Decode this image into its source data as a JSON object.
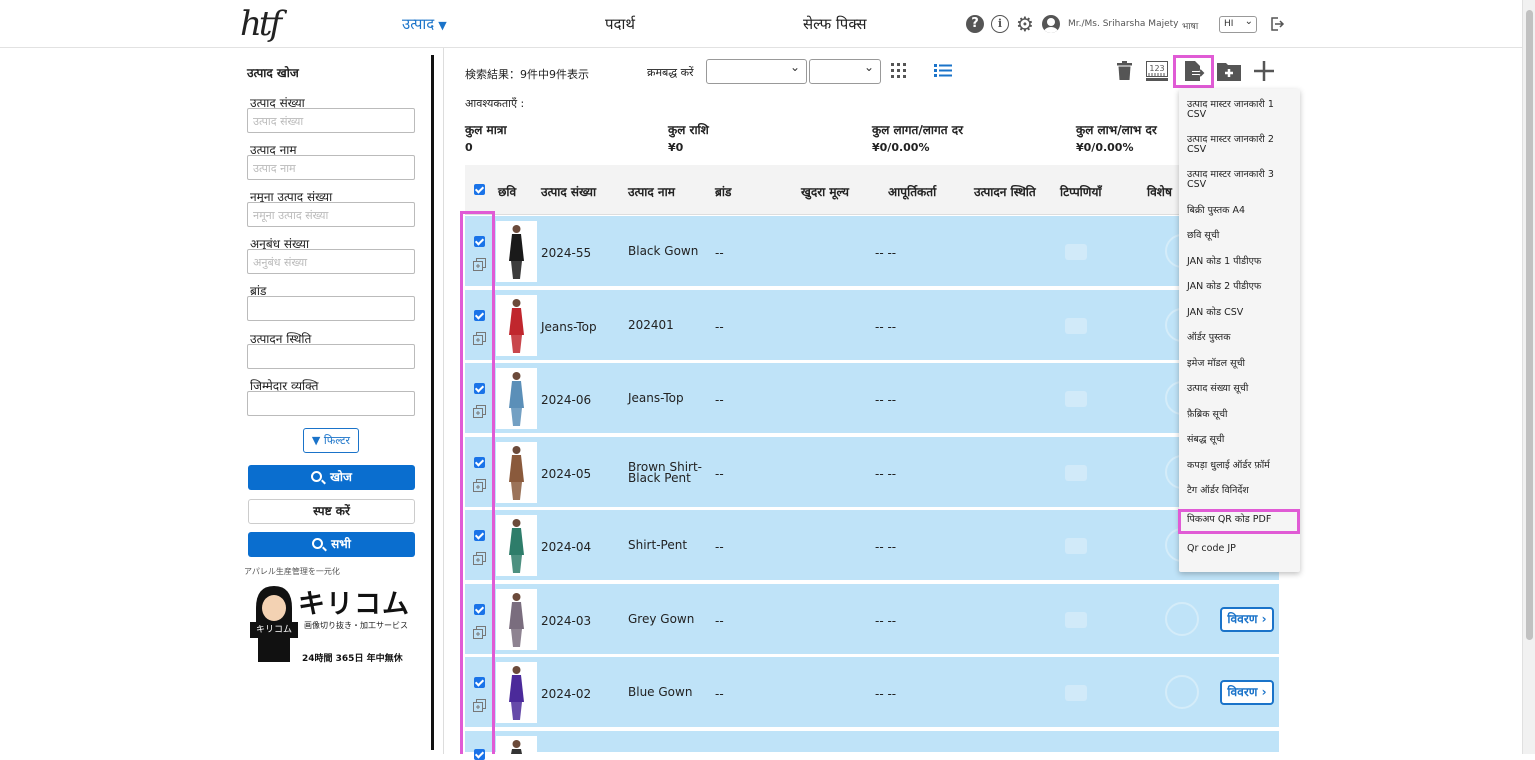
{
  "header": {
    "nav": {
      "products": "उत्पाद",
      "materials": "पदार्थ",
      "shelf_picks": "सेल्फ पिक्स"
    },
    "help_glyph": "?",
    "info_glyph": "i",
    "username": "Mr./Ms. Sriharsha Majety",
    "language_label": "भाषा",
    "language_value": "HI"
  },
  "sidebar": {
    "title": "उत्पाद खोज",
    "fields": [
      {
        "label": "उत्पाद संख्या",
        "placeholder": "उत्पाद संख्या"
      },
      {
        "label": "उत्पाद नाम",
        "placeholder": "उत्पाद नाम"
      },
      {
        "label": "नमूना उत्पाद संख्या",
        "placeholder": "नमूना उत्पाद संख्या"
      },
      {
        "label": "अनुबंध संख्या",
        "placeholder": "अनुबंध संख्या"
      },
      {
        "label": "ब्रांड",
        "placeholder": ""
      },
      {
        "label": "उत्पादन स्थिति",
        "placeholder": ""
      },
      {
        "label": "जिम्मेदार व्यक्ति",
        "placeholder": ""
      }
    ],
    "filter_label": "फिल्टर",
    "search_label": "खोज",
    "clear_label": "स्पष्ट करें",
    "all_label": "सभी",
    "ad": {
      "caption": "アパレル生産管理を一元化",
      "title": "キリコム",
      "subtitle": "画像切り抜き・加工サービス",
      "badge": "キリコム",
      "hours": "24時間 365日 年中無休"
    }
  },
  "main": {
    "result_text": "検索結果：9件中9件表示",
    "sort_label": "क्रमबद्ध करें",
    "requirements_label": "आवश्यकताएँ :",
    "summary": [
      {
        "label": "कुल मात्रा",
        "value": "0"
      },
      {
        "label": "कुल राशि",
        "value": "¥0"
      },
      {
        "label": "कुल लागत/लागत दर",
        "value": "¥0/0.00%"
      },
      {
        "label": "कुल लाभ/लाभ दर",
        "value": "¥0/0.00%"
      }
    ],
    "toolbar": {
      "barcode_text": "123"
    },
    "columns": [
      "छवि",
      "उत्पाद संख्या",
      "उत्पाद नाम",
      "ब्रांड",
      "खुदरा मूल्य",
      "आपूर्तिकर्ता",
      "उत्पादन स्थिति",
      "टिप्पणियाँ",
      "विशेष"
    ],
    "detail_label": "विवरण",
    "rows": [
      {
        "number": "2024-55",
        "name": "Black Gown",
        "brand": "--",
        "price": "-- --",
        "color": "#1a1a1a"
      },
      {
        "number": "Jeans-Top",
        "name": "202401",
        "brand": "--",
        "price": "-- --",
        "color": "#c0262d"
      },
      {
        "number": "2024-06",
        "name": "Jeans-Top",
        "brand": "--",
        "price": "-- --",
        "color": "#5b8fb8"
      },
      {
        "number": "2024-05",
        "name": "Brown Shirt-\nBlack Pent",
        "brand": "--",
        "price": "-- --",
        "color": "#8a5a3c"
      },
      {
        "number": "2024-04",
        "name": "Shirt-Pent",
        "brand": "--",
        "price": "-- --",
        "color": "#2e7d6a"
      },
      {
        "number": "2024-03",
        "name": "Grey Gown",
        "brand": "--",
        "price": "-- --",
        "color": "#7a6d7e"
      },
      {
        "number": "2024-02",
        "name": "Blue Gown",
        "brand": "--",
        "price": "-- --",
        "color": "#4b2a9a"
      }
    ]
  },
  "export_menu": {
    "items": [
      "उत्पाद मास्टर जानकारी 1 CSV",
      "उत्पाद मास्टर जानकारी 2 CSV",
      "उत्पाद मास्टर जानकारी 3 CSV",
      "बिक्री पुस्तक A4",
      "छवि सूची",
      "JAN कोड 1 पीडीएफ",
      "JAN कोड 2 पीडीएफ",
      "JAN कोड CSV",
      "ऑर्डर पुस्तक",
      "इमेज मॉडल सूची",
      "उत्पाद संख्या सूची",
      "फ़ैब्रिक सूची",
      "संबद्ध सूची",
      "कपड़ा धुलाई ऑर्डर फ़ॉर्म",
      "टैग ऑर्डर विनिर्देश",
      "पिकअप QR कोड PDF",
      "Qr code JP"
    ]
  },
  "colors": {
    "accent": "#1a73c9",
    "row_bg": "#bfe3f8",
    "highlight": "#e05bd5"
  }
}
